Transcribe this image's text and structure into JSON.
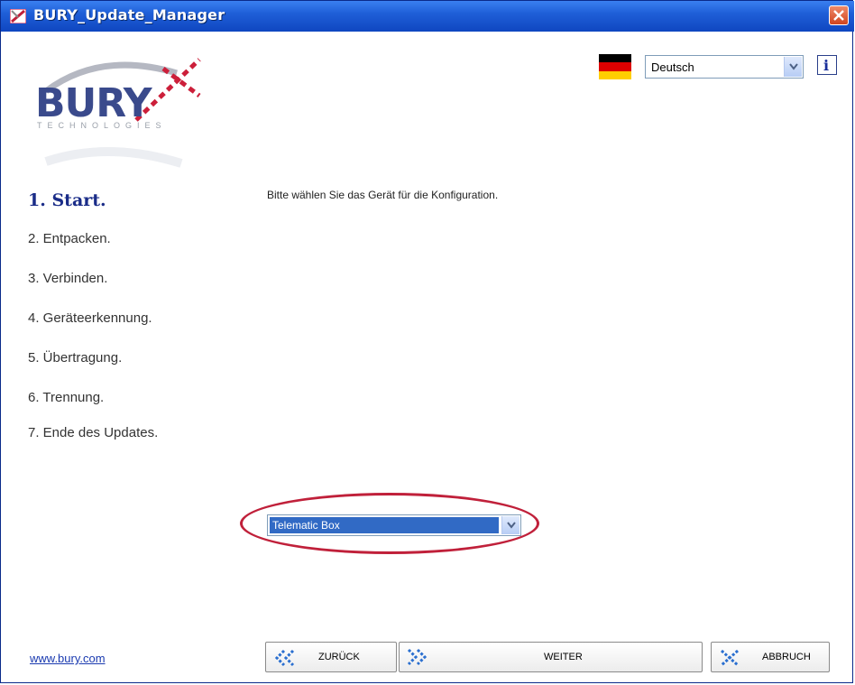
{
  "window": {
    "title": "BURY_Update_Manager"
  },
  "logo": {
    "brand": "BURY",
    "sub": "TECHNOLOGIES"
  },
  "language": {
    "selected": "Deutsch"
  },
  "steps": [
    {
      "label": "1. Start."
    },
    {
      "label": "2. Entpacken."
    },
    {
      "label": "3. Verbinden."
    },
    {
      "label": "4. Geräteerkennung."
    },
    {
      "label": "5. Übertragung."
    },
    {
      "label": "6. Trennung."
    },
    {
      "label": "7. Ende des Updates."
    }
  ],
  "main": {
    "prompt": "Bitte wählen Sie das Gerät für die Konfiguration.",
    "device_selected": "Telematic Box"
  },
  "footer": {
    "link": "www.bury.com",
    "back_label": "ZURÜCK",
    "next_label": "WEITER",
    "cancel_label": "ABBRUCH"
  },
  "colors": {
    "titlebar": "#1f5fd8",
    "accent": "#1a2c88",
    "highlight": "#c0203a",
    "selection": "#316ac5"
  },
  "icons": [
    "app-icon",
    "close-icon",
    "german-flag-icon",
    "info-icon",
    "chevron-down-icon",
    "back-arrows-icon",
    "forward-arrows-icon",
    "cancel-x-icon"
  ]
}
